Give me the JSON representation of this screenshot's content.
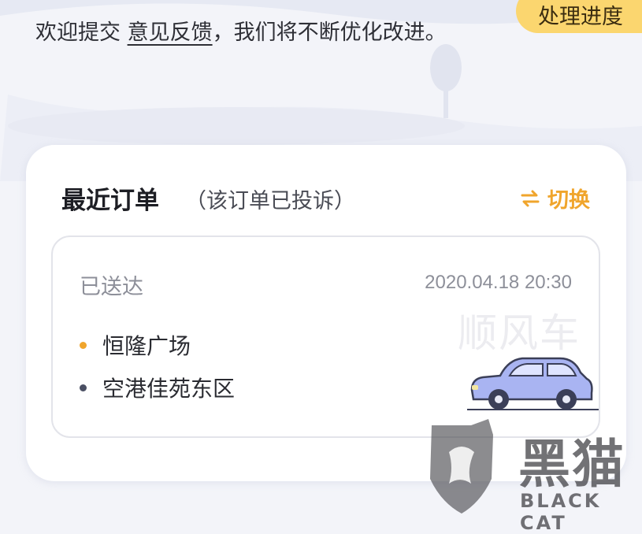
{
  "header": {
    "progress_button": "处理进度",
    "intro_prefix": "欢迎提交",
    "intro_link": "意见反馈",
    "intro_suffix": "，我们将不断优化改进。"
  },
  "recent_order": {
    "title": "最近订单",
    "note": "（该订单已投诉）",
    "switch_label": "切换",
    "status": "已送达",
    "datetime": "2020.04.18 20:30",
    "pickup": "恒隆广场",
    "dropoff": "空港佳苑东区",
    "watermark": "顺风车"
  },
  "overlay_watermark": {
    "cn": "黑猫",
    "en": "BLACK CAT"
  },
  "colors": {
    "accent": "#f0a52c",
    "pickup_dot": "#f0a52c",
    "dropoff_dot": "#4a4f63",
    "progress_bg": "#fbd66f"
  }
}
